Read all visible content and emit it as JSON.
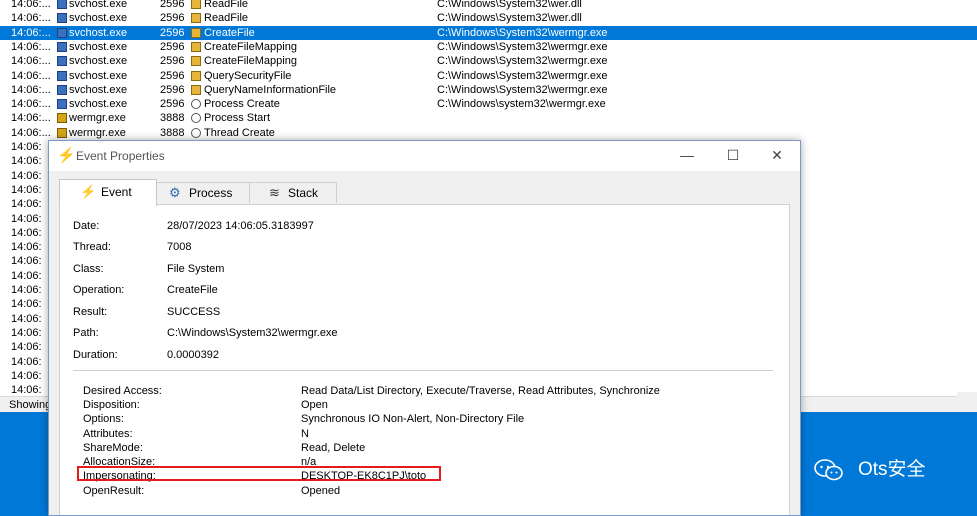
{
  "background_list": {
    "rows": [
      {
        "time": "14:06:...",
        "process": "svchost.exe",
        "pid": "2596",
        "operation": "ReadFile",
        "path": "C:\\Windows\\System32\\wer.dll",
        "proc_icon": "svchost",
        "op_icon": "file"
      },
      {
        "time": "14:06:...",
        "process": "svchost.exe",
        "pid": "2596",
        "operation": "ReadFile",
        "path": "C:\\Windows\\System32\\wer.dll",
        "proc_icon": "svchost",
        "op_icon": "file"
      },
      {
        "time": "14:06:...",
        "process": "svchost.exe",
        "pid": "2596",
        "operation": "CreateFile",
        "path": "C:\\Windows\\System32\\wermgr.exe",
        "proc_icon": "svchost",
        "op_icon": "file",
        "selected": true
      },
      {
        "time": "14:06:...",
        "process": "svchost.exe",
        "pid": "2596",
        "operation": "CreateFileMapping",
        "path": "C:\\Windows\\System32\\wermgr.exe",
        "proc_icon": "svchost",
        "op_icon": "file"
      },
      {
        "time": "14:06:...",
        "process": "svchost.exe",
        "pid": "2596",
        "operation": "CreateFileMapping",
        "path": "C:\\Windows\\System32\\wermgr.exe",
        "proc_icon": "svchost",
        "op_icon": "file"
      },
      {
        "time": "14:06:...",
        "process": "svchost.exe",
        "pid": "2596",
        "operation": "QuerySecurityFile",
        "path": "C:\\Windows\\System32\\wermgr.exe",
        "proc_icon": "svchost",
        "op_icon": "file"
      },
      {
        "time": "14:06:...",
        "process": "svchost.exe",
        "pid": "2596",
        "operation": "QueryNameInformationFile",
        "path": "C:\\Windows\\System32\\wermgr.exe",
        "proc_icon": "svchost",
        "op_icon": "file"
      },
      {
        "time": "14:06:...",
        "process": "svchost.exe",
        "pid": "2596",
        "operation": "Process Create",
        "path": "C:\\Windows\\system32\\wermgr.exe",
        "proc_icon": "svchost",
        "op_icon": "process"
      },
      {
        "time": "14:06:...",
        "process": "wermgr.exe",
        "pid": "3888",
        "operation": "Process Start",
        "path": "",
        "proc_icon": "wermgr",
        "op_icon": "process"
      },
      {
        "time": "14:06:...",
        "process": "wermgr.exe",
        "pid": "3888",
        "operation": "Thread Create",
        "path": "",
        "proc_icon": "wermgr",
        "op_icon": "process"
      }
    ],
    "extra_times": [
      "14:06:",
      "14:06:",
      "14:06:",
      "14:06:",
      "14:06:",
      "14:06:",
      "14:06:",
      "14:06:",
      "14:06:",
      "14:06:",
      "14:06:",
      "14:06:",
      "14:06:",
      "14:06:",
      "14:06:",
      "14:06:",
      "14:06:",
      "14:06:"
    ],
    "status_text": "Showing"
  },
  "dialog": {
    "title": "Event Properties",
    "title_icon": "lightning-icon",
    "controls": {
      "minimize": "—",
      "maximize": "☐",
      "close": "✕"
    },
    "tabs": [
      {
        "label": "Event",
        "icon": "lightning-icon",
        "active": true
      },
      {
        "label": "Process",
        "icon": "gear-icon",
        "active": false
      },
      {
        "label": "Stack",
        "icon": "stack-icon",
        "active": false
      }
    ],
    "fields": [
      {
        "label": "Date:",
        "value": "28/07/2023 14:06:05.3183997"
      },
      {
        "label": "Thread:",
        "value": "7008"
      },
      {
        "label": "Class:",
        "value": "File System"
      },
      {
        "label": "Operation:",
        "value": "CreateFile"
      },
      {
        "label": "Result:",
        "value": "SUCCESS"
      },
      {
        "label": "Path:",
        "value": "C:\\Windows\\System32\\wermgr.exe"
      },
      {
        "label": "Duration:",
        "value": "0.0000392"
      }
    ],
    "details": [
      {
        "label": "Desired Access:",
        "value": "Read Data/List Directory, Execute/Traverse, Read Attributes, Synchronize"
      },
      {
        "label": "Disposition:",
        "value": "Open"
      },
      {
        "label": "Options:",
        "value": "Synchronous IO Non-Alert, Non-Directory File"
      },
      {
        "label": "Attributes:",
        "value": "N"
      },
      {
        "label": "ShareMode:",
        "value": "Read, Delete"
      },
      {
        "label": "AllocationSize:",
        "value": "n/a"
      },
      {
        "label": "Impersonating:",
        "value": "DESKTOP-EK8C1PJ\\toto",
        "highlighted": true
      },
      {
        "label": "OpenResult:",
        "value": "Opened"
      }
    ]
  },
  "colors": {
    "selection": "#0078d7",
    "highlight_box": "#e51b1b",
    "desktop": "#0078d7"
  },
  "watermark": {
    "text": "Ots安全"
  }
}
